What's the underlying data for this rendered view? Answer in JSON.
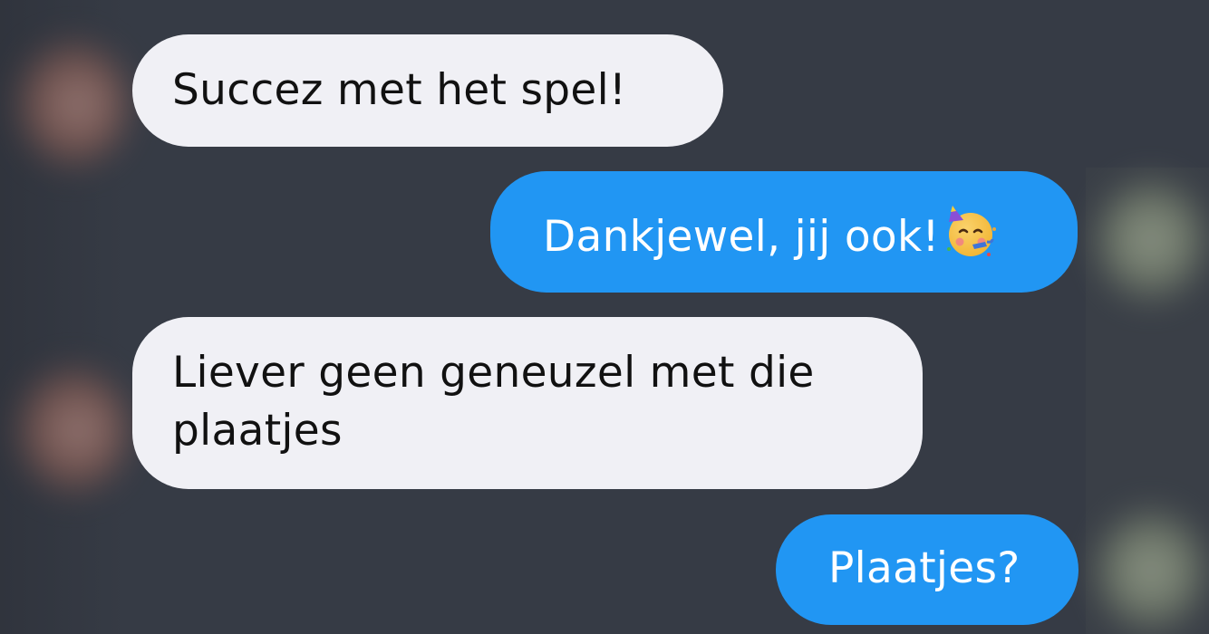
{
  "conversation": {
    "messages": [
      {
        "direction": "incoming",
        "text": "Succez met het spel!"
      },
      {
        "direction": "outgoing",
        "text": "Dankjewel, jij ook!",
        "emoji": "partying-face-icon"
      },
      {
        "direction": "incoming",
        "text": "Liever geen geneuzel met die plaatjes"
      },
      {
        "direction": "outgoing",
        "text": "Plaatjes?"
      }
    ]
  },
  "colors": {
    "background": "#363b45",
    "incoming_bubble": "#f0f0f5",
    "outgoing_bubble": "#2196f3"
  }
}
